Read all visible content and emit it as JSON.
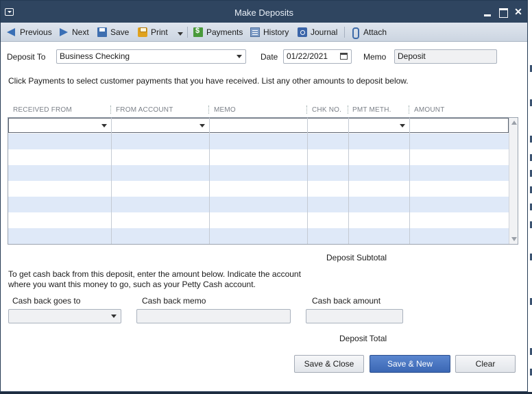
{
  "window": {
    "title": "Make Deposits"
  },
  "toolbar": {
    "previous": "Previous",
    "next": "Next",
    "save": "Save",
    "print": "Print",
    "payments": "Payments",
    "history": "History",
    "journal": "Journal",
    "attach": "Attach"
  },
  "header": {
    "deposit_to_label": "Deposit To",
    "deposit_to_value": "Business Checking",
    "date_label": "Date",
    "date_value": "01/22/2021",
    "memo_label": "Memo",
    "memo_value": "Deposit"
  },
  "instructions": "Click Payments to select customer payments that you have received. List any other amounts to deposit below.",
  "grid": {
    "columns": [
      "RECEIVED FROM",
      "FROM ACCOUNT",
      "MEMO",
      "CHK NO.",
      "PMT METH.",
      "AMOUNT"
    ],
    "rows": [
      [
        "",
        "",
        "",
        "",
        "",
        ""
      ],
      [
        "",
        "",
        "",
        "",
        "",
        ""
      ],
      [
        "",
        "",
        "",
        "",
        "",
        ""
      ],
      [
        "",
        "",
        "",
        "",
        "",
        ""
      ],
      [
        "",
        "",
        "",
        "",
        "",
        ""
      ],
      [
        "",
        "",
        "",
        "",
        "",
        ""
      ],
      [
        "",
        "",
        "",
        "",
        "",
        ""
      ],
      [
        "",
        "",
        "",
        "",
        "",
        ""
      ]
    ]
  },
  "subtotal_label": "Deposit Subtotal",
  "cashback": {
    "note_line1": "To get cash back from this deposit, enter the amount below.  Indicate the account",
    "note_line2": "where you want this money to go, such as your Petty Cash account.",
    "goes_to_label": "Cash back goes to",
    "goes_to_value": "",
    "memo_label": "Cash back memo",
    "memo_value": "",
    "amount_label": "Cash back amount",
    "amount_value": ""
  },
  "total_label": "Deposit Total",
  "buttons": {
    "save_close": "Save & Close",
    "save_new": "Save & New",
    "clear": "Clear"
  },
  "colors": {
    "titlebar": "#2f4560",
    "row_alt": "#dfe9f8",
    "primary_button": "#3b67b4"
  }
}
